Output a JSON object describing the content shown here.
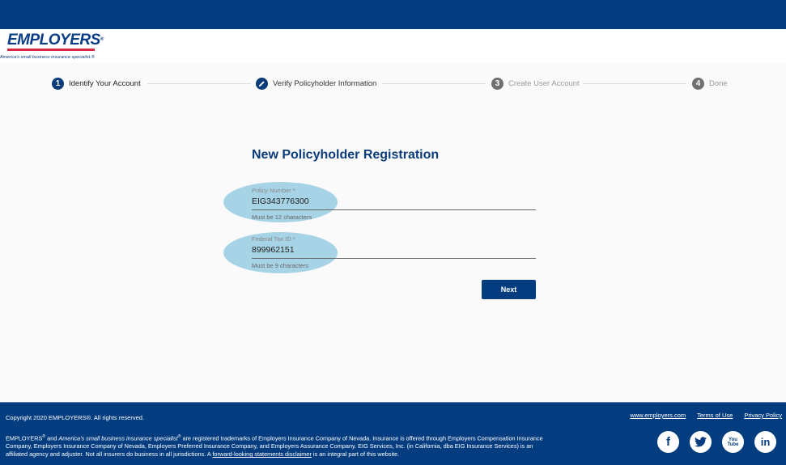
{
  "header": {
    "logo_text": "EMPLOYERS",
    "logo_mark": "®",
    "tagline": "America's small business insurance specialist.®"
  },
  "stepper": {
    "steps": [
      {
        "number": "1",
        "label": "Identify Your Account",
        "state": "active",
        "icon": "number-1-icon"
      },
      {
        "number": "",
        "label": "Verify Policyholder Information",
        "state": "active",
        "icon": "pencil-icon"
      },
      {
        "number": "3",
        "label": "Create User Account",
        "state": "inactive",
        "icon": "number-3-icon"
      },
      {
        "number": "4",
        "label": "Done",
        "state": "inactive",
        "icon": "number-4-icon"
      }
    ]
  },
  "form": {
    "title": "New Policyholder Registration",
    "fields": [
      {
        "label": "Policy Number *",
        "value": "EIG343776300",
        "hint": "Must be 12 characters"
      },
      {
        "label": "Federal Tax ID *",
        "value": "899962151",
        "hint": "Must be 9 characters"
      }
    ],
    "next_label": "Next"
  },
  "footer": {
    "copyright": "Copyright 2020 EMPLOYERS®. All rights reserved.",
    "legal_part1": "EMPLOYERS",
    "legal_part2": " and ",
    "legal_italic": "America's small business insurance specialist",
    "legal_part3": " are registered trademarks of Employers Insurance Company of Nevada. Insurance is offered through Employers Compensation Insurance Company, Employers Insurance Company of Nevada, Employers Preferred Insurance Company, and Employers Assurance Company. EIG Services, Inc. (in California, dba EIG Insurance Services) is an affiliated agency and adjuster. Not all insurers do business in all jurisdictions. A ",
    "legal_link": "forward-looking statements disclaimer",
    "legal_part4": " is an integral part of this website.",
    "links": [
      "www.employers.com",
      "Terms of Use",
      "Privacy Policy"
    ],
    "social": [
      {
        "name": "facebook",
        "glyph": "f"
      },
      {
        "name": "twitter",
        "glyph": "🐦"
      },
      {
        "name": "youtube",
        "glyph": "You Tube"
      },
      {
        "name": "linkedin",
        "glyph": "in"
      }
    ]
  },
  "colors": {
    "brand_blue": "#033d7f",
    "accent_red": "#d7263d",
    "highlight": "#a7d3e6"
  }
}
